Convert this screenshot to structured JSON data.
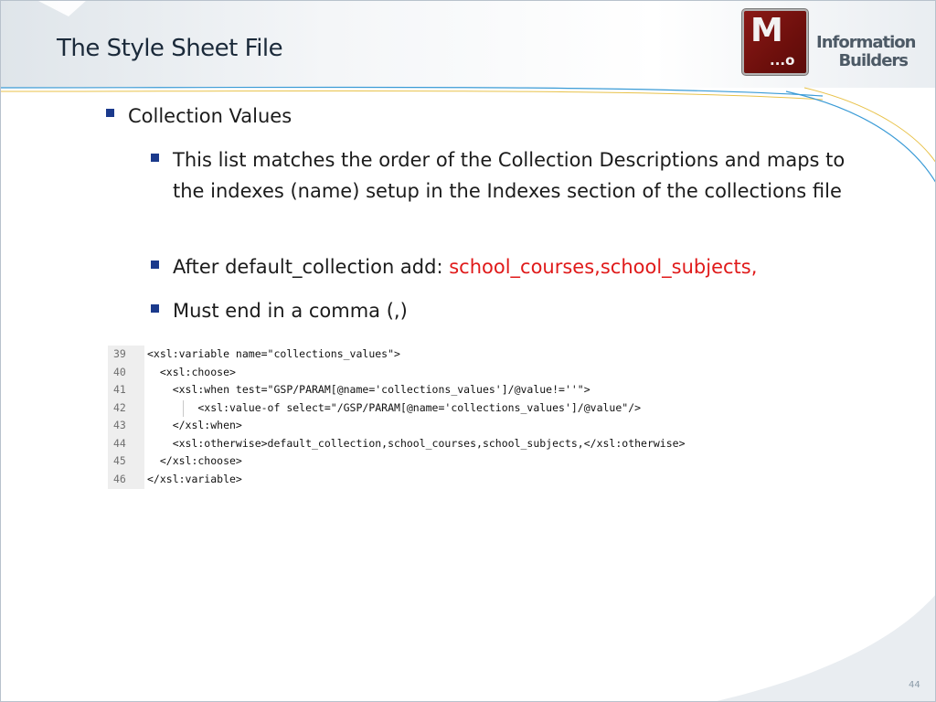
{
  "slide": {
    "title": "The Style Sheet File",
    "page_number": "44"
  },
  "logo": {
    "letter": "M",
    "dots": "...o",
    "brand_line1": "Information",
    "brand_line2": "Builders",
    "colors": {
      "box": "#7a1310",
      "brand_text": "#4d5a66"
    }
  },
  "bullets": {
    "level1": "Collection Values",
    "level2": [
      {
        "text": "This list matches the order of the Collection Descriptions and maps to the indexes (name) setup in the Indexes section of the collections file"
      },
      {
        "text": "After default_collection add: ",
        "highlight": "school_courses,school_subjects,"
      },
      {
        "text": "Must end in a comma (,)"
      }
    ],
    "bullet_color": "#1b3a8c",
    "highlight_color": "#e01a1a"
  },
  "code": {
    "lines": [
      {
        "num": "39",
        "text": "<xsl:variable name=\"collections_values\">"
      },
      {
        "num": "40",
        "text": "  <xsl:choose>"
      },
      {
        "num": "41",
        "text": "    <xsl:when test=\"GSP/PARAM[@name='collections_values']/@value!=''\">"
      },
      {
        "num": "42",
        "text": "        <xsl:value-of select=\"/GSP/PARAM[@name='collections_values']/@value\"/>"
      },
      {
        "num": "43",
        "text": "    </xsl:when>"
      },
      {
        "num": "44",
        "text": "    <xsl:otherwise>default_collection,school_courses,school_subjects,</xsl:otherwise>"
      },
      {
        "num": "45",
        "text": "  </xsl:choose>"
      },
      {
        "num": "46",
        "text": "</xsl:variable>"
      }
    ]
  },
  "theme": {
    "accent_blue": "#3a9bd6",
    "accent_gold": "#e8c24a"
  }
}
